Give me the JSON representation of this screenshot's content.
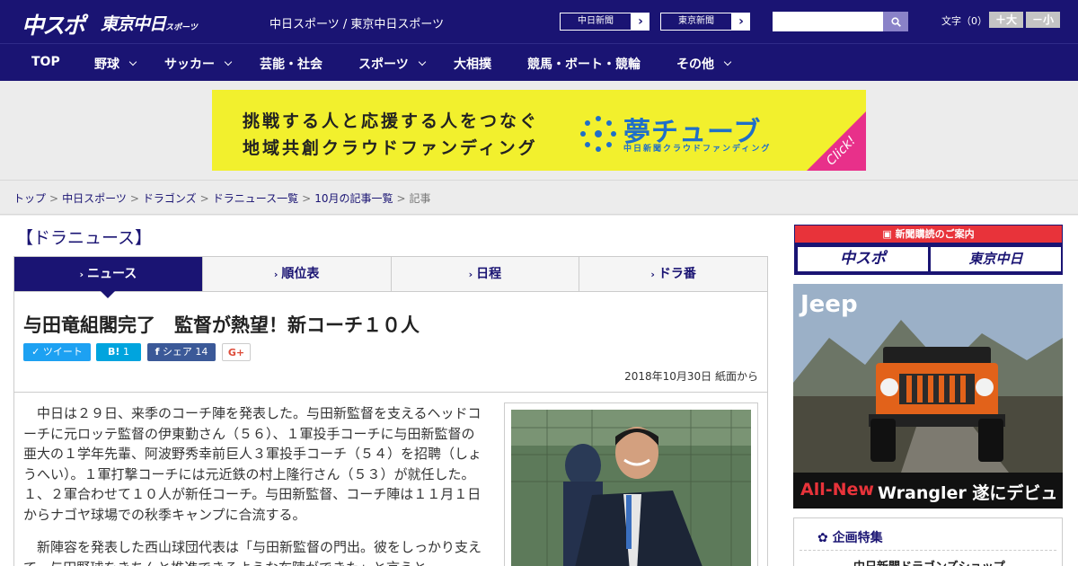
{
  "header": {
    "logo_chuspo": "中スポ",
    "logo_tokyo": "東京中日",
    "logo_tokyo_sub": "スポーツ",
    "site_name": "中日スポーツ / 東京中日スポーツ",
    "ext_links": [
      {
        "label": "中日新聞"
      },
      {
        "label": "東京新聞"
      }
    ],
    "search": {
      "value": "",
      "placeholder": ""
    },
    "font_size_label": "文字（0）",
    "font_up": "＋大",
    "font_down": "－小"
  },
  "nav": {
    "items": [
      {
        "label": "TOP",
        "dropdown": false
      },
      {
        "label": "野球",
        "dropdown": true
      },
      {
        "label": "サッカー",
        "dropdown": true
      },
      {
        "label": "芸能・社会",
        "dropdown": false
      },
      {
        "label": "スポーツ",
        "dropdown": true
      },
      {
        "label": "大相撲",
        "dropdown": false
      },
      {
        "label": "競馬・ボート・競輪",
        "dropdown": false
      },
      {
        "label": "その他",
        "dropdown": true
      }
    ]
  },
  "banner": {
    "line1": "挑戦する人と応援する人をつなぐ",
    "line2": "地域共創クラウドファンディング",
    "brand": "夢チューブ",
    "brand_sub": "中日新聞クラウドファンディング",
    "cta": "Click!"
  },
  "breadcrumb": {
    "links": [
      "トップ",
      "中日スポーツ",
      "ドラゴンズ",
      "ドラニュース一覧",
      "10月の記事一覧"
    ],
    "current": "記事"
  },
  "section_title": "【ドラニュース】",
  "tabs": [
    {
      "label": "ニュース",
      "active": true
    },
    {
      "label": "順位表",
      "active": false
    },
    {
      "label": "日程",
      "active": false
    },
    {
      "label": "ドラ番",
      "active": false
    }
  ],
  "article": {
    "title": "与田竜組閣完了　監督が熱望！新コーチ１０人",
    "share": {
      "tweet": "ツイート",
      "hatena_label": "B!",
      "hatena_count": "1",
      "fb_label": "シェア",
      "fb_count": "14",
      "gplus": "G+"
    },
    "date": "2018年10月30日 紙面から",
    "paragraphs": [
      "中日は２９日、来季のコーチ陣を発表した。与田新監督を支えるヘッドコーチに元ロッテ監督の伊東勤さん（５６）、１軍投手コーチに与田新監督の亜大の１学年先輩、阿波野秀幸前巨人３軍投手コーチ（５４）を招聘（しょうへい）。１軍打撃コーチには元近鉄の村上隆行さん（５３）が就任した。１、２軍合わせて１０人が新任コーチ。与田新監督、コーチ陣は１１月１日からナゴヤ球場での秋季キャンプに合流する。",
      "新陣容を発表した西山球団代表は「与田新監督の門出。彼をしっかり支えて、与田野球をきちんと推進できるような布陣ができた」と言うと"
    ]
  },
  "sidebar": {
    "subscribe_head": "新聞購読のご案内",
    "subscribe_logos": [
      "中スポ",
      "東京中日"
    ],
    "ad": {
      "logo": "Jeep",
      "tag_a": "All-New",
      "tag_b": "Wrangler 遂にデビュー"
    },
    "feature_title": "企画特集",
    "feature_item": "中日新聞ドラゴンズショップ"
  },
  "colors": {
    "brand_navy": "#1a1473",
    "accent_red": "#e8333a",
    "banner_yellow": "#f2f02d"
  }
}
